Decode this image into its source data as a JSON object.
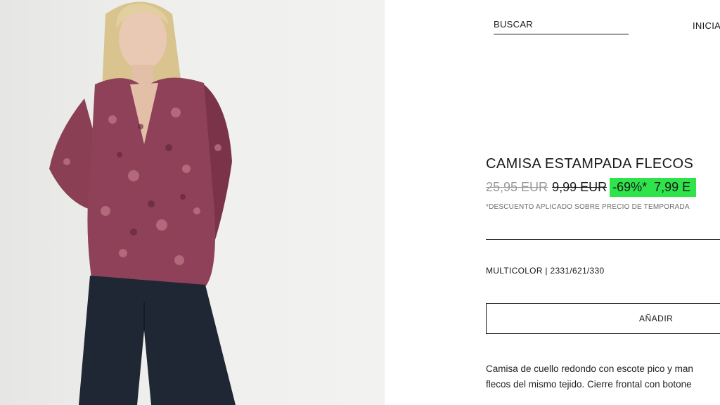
{
  "header": {
    "search_label": "BUSCAR",
    "login_label": "INICIA"
  },
  "product": {
    "title": "CAMISA ESTAMPADA FLECOS",
    "price_original": "25,95 EUR",
    "price_previous": "9,99 EUR",
    "discount": "-69%*",
    "price_final": "7,99 E",
    "discount_note": "*DESCUENTO APLICADO SOBRE PRECIO DE TEMPORADA",
    "color_ref": "MULTICOLOR | 2331/621/330",
    "add_label": "AÑADIR",
    "description_line1": "Camisa de cuello redondo con escote pico y man",
    "description_line2": "flecos del mismo tejido. Cierre frontal con botone"
  },
  "colors": {
    "highlight": "#2fe34a",
    "text": "#1a1a1a",
    "muted": "#9a9a9a"
  }
}
